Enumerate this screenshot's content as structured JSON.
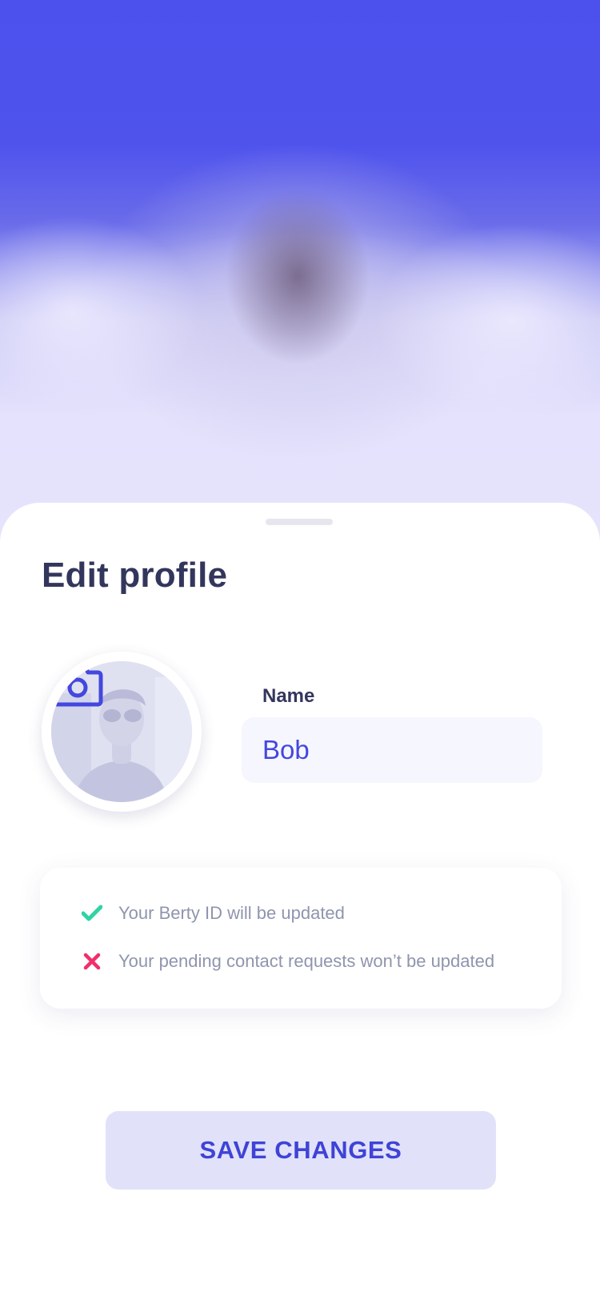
{
  "sheet": {
    "title": "Edit profile"
  },
  "avatar": {
    "icon": "camera-icon"
  },
  "name_field": {
    "label": "Name",
    "value": "Bob"
  },
  "info": {
    "items": [
      {
        "icon": "check-icon",
        "color": "#2ed3a6",
        "text": "Your Berty ID will be updated"
      },
      {
        "icon": "cross-icon",
        "color": "#f0306a",
        "text": "Your pending contact requests won’t be updated"
      }
    ]
  },
  "actions": {
    "save_label": "SAVE CHANGES"
  },
  "colors": {
    "accent": "#4447de",
    "title": "#33365c",
    "background_top": "#4c51ee"
  }
}
